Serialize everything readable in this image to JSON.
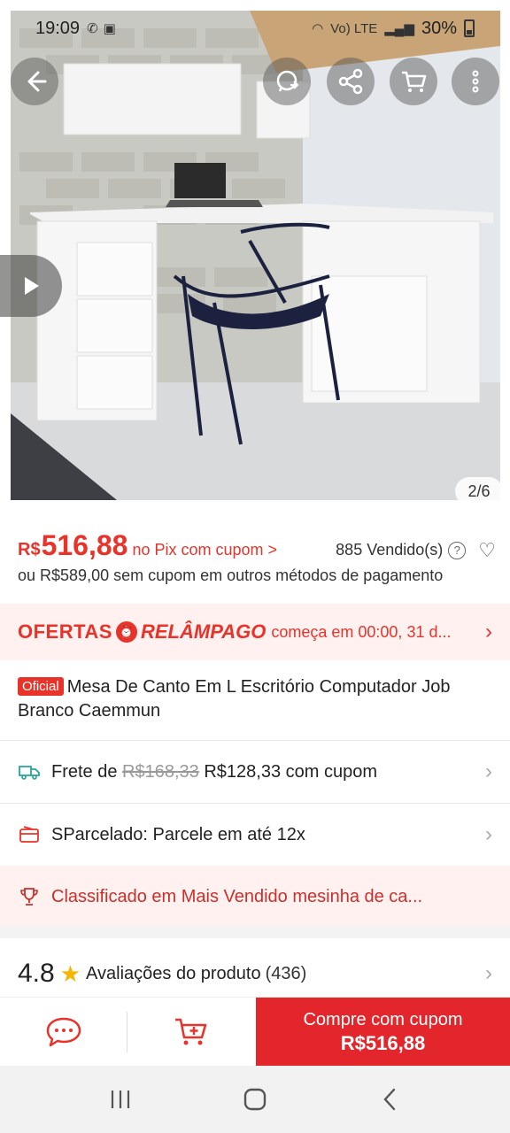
{
  "status_bar": {
    "time": "19:09",
    "network": "Vo) LTE",
    "battery": "30%"
  },
  "hero": {
    "counter": "2/6"
  },
  "price": {
    "currency": "R$",
    "value": "516,88",
    "pix_label": "no Pix com cupom >",
    "sold": "885 Vendido(s)",
    "alt_price": "ou R$589,00 sem cupom em outros métodos de pagamento"
  },
  "flash_sale": {
    "ofertas": "OFERTAS",
    "relampago": "RELÂMPAGO",
    "starts": "começa em 00:00, 31 d..."
  },
  "product": {
    "badge": "Oficial",
    "title": "Mesa De Canto Em L Escritório Computador Job Branco Caemmun"
  },
  "shipping": {
    "prefix": "Frete de",
    "old_price": "R$168,33",
    "new_price": "R$128,33 com cupom"
  },
  "installments": {
    "text": "SParcelado: Parcele em até 12x"
  },
  "ranking": {
    "text": "Classificado em Mais Vendido mesinha de ca..."
  },
  "rating": {
    "score": "4.8",
    "label": "Avaliações do produto",
    "count": "(436)"
  },
  "bottom_bar": {
    "buy_line1": "Compre com cupom",
    "buy_line2": "R$516,88"
  },
  "colors": {
    "accent": "#e8332a",
    "buy_button": "#e3262b",
    "flash_bg": "#fff1ef"
  },
  "icons": [
    "back-icon",
    "whatsapp-icon",
    "share-icon",
    "cart-icon",
    "more-icon",
    "play-icon",
    "help-icon",
    "heart-icon",
    "clock-icon",
    "truck-icon",
    "installments-icon",
    "trophy-icon",
    "star-icon",
    "chat-icon",
    "add-cart-icon",
    "recents-icon",
    "home-icon",
    "nav-back-icon"
  ]
}
